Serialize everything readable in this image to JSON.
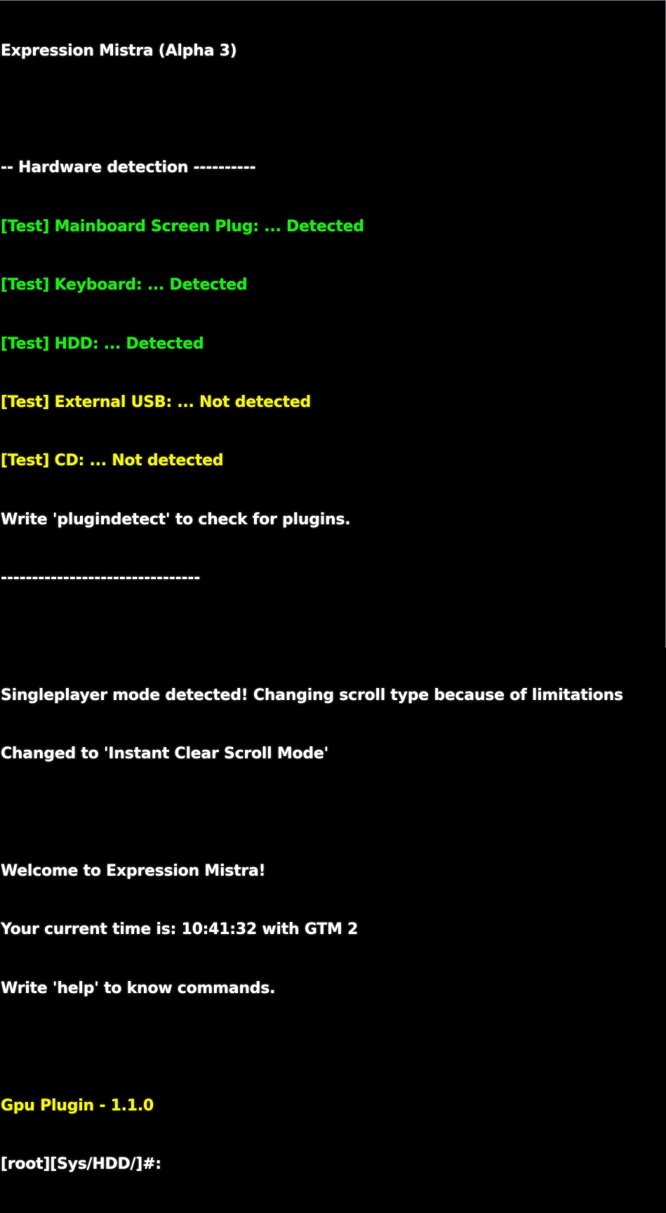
{
  "colors": {
    "background": "#000000",
    "text_white": "#ffffff",
    "text_green": "#22e61c",
    "text_yellow": "#f2f21f"
  },
  "console": {
    "title": "Expression Mistra (Alpha 3)",
    "hardware_header": "-- Hardware detection ----------",
    "tests": [
      {
        "text": "[Test] Mainboard Screen Plug: ... Detected",
        "status": "detected"
      },
      {
        "text": "[Test] Keyboard: ... Detected",
        "status": "detected"
      },
      {
        "text": "[Test] HDD: ... Detected",
        "status": "detected"
      },
      {
        "text": "[Test] External USB: ... Not detected",
        "status": "not-detected"
      },
      {
        "text": "[Test] CD: ... Not detected",
        "status": "not-detected"
      }
    ],
    "plugin_hint": "Write 'plugindetect' to check for plugins.",
    "separator": "--------------------------------",
    "singleplayer_notice": "Singleplayer mode detected! Changing scroll type because of limitations",
    "scroll_mode_notice": "Changed to 'Instant Clear Scroll Mode'",
    "welcome": "Welcome to Expression Mistra!",
    "current_time": "Your current time is: 10:41:32 with GTM 2",
    "help_hint": "Write 'help' to know commands.",
    "gpu_plugin": "Gpu Plugin - 1.1.0",
    "prompt": "[root][Sys/HDD/]#:",
    "input_value": ""
  }
}
